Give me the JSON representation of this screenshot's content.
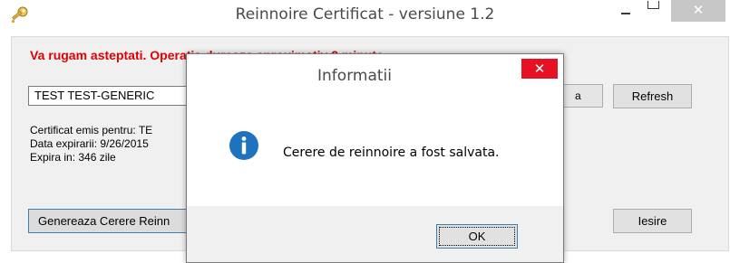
{
  "main_window": {
    "title": "Reinnoire Certificat - versiune 1.2",
    "app_icon": "key-icon",
    "close_glyph": "✕",
    "wait_message": "Va rugam asteptati. Operatia dureaza aproximativ 2 minute",
    "certificate_select": {
      "value": "TEST TEST-GENERIC"
    },
    "partial_button_label": "a",
    "refresh_label": "Refresh",
    "info": {
      "issued_for": "Certificat emis pentru: TE",
      "expiry_date": "Data expirarii: 9/26/2015",
      "expires_in": "Expira in: 346 zile"
    },
    "generate_label": "Genereaza Cerere Reinn",
    "exit_label": "Iesire"
  },
  "dialog": {
    "title": "Informatii",
    "close_glyph": "✕",
    "icon": "info-icon",
    "message": "Cerere de reinnoire a fost salvata.",
    "ok_label": "OK"
  },
  "colors": {
    "accent_red": "#e00000",
    "dialog_close": "#e81123",
    "info_icon": "#1e73be"
  }
}
